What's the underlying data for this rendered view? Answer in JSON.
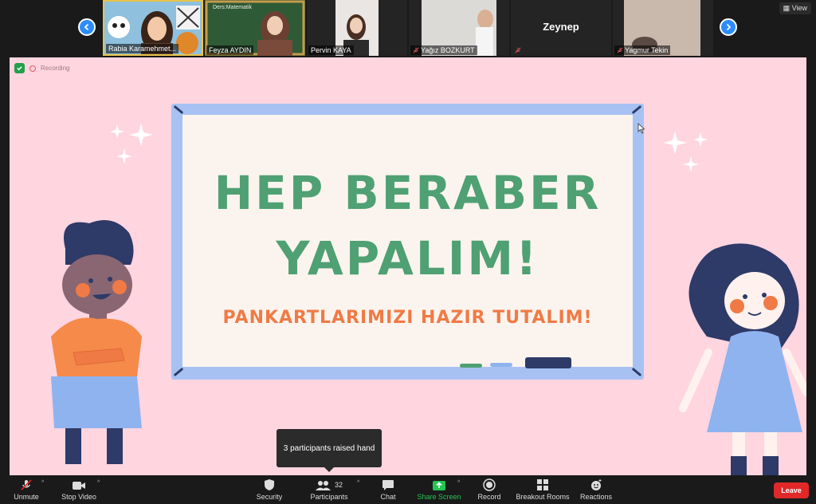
{
  "gallery": {
    "tiles": [
      {
        "name": "Rabia Karamehmet..."
      },
      {
        "name": "Feyza AYDIN"
      },
      {
        "name": "Pervin KAYA"
      },
      {
        "name": "Yağız BOZKURT"
      },
      {
        "name": "Zeynep"
      },
      {
        "name": "Yagmur Tekin"
      }
    ],
    "view_label": "View",
    "chalkboard_text": "Ders:Matematik"
  },
  "share": {
    "recording_label": "Recording",
    "title_line1": "HEP BERABER",
    "title_line2": "YAPALIM!",
    "subtitle": "PANKARTLARIMIZI HAZIR TUTALIM!"
  },
  "tooltip": {
    "text": "3 participants raised hand"
  },
  "toolbar": {
    "unmute": "Unmute",
    "stop_video": "Stop Video",
    "security": "Security",
    "participants": "Participants",
    "participants_count": "32",
    "chat": "Chat",
    "share_screen": "Share Screen",
    "record": "Record",
    "breakout_rooms": "Breakout Rooms",
    "reactions": "Reactions",
    "leave": "Leave"
  },
  "colors": {
    "accent": "#2d8cff",
    "slide_bg": "#ffd5e0",
    "title_green": "#4fa073",
    "subtitle_orange": "#f07a45",
    "leave_red": "#e02828",
    "share_green": "#23c552"
  }
}
